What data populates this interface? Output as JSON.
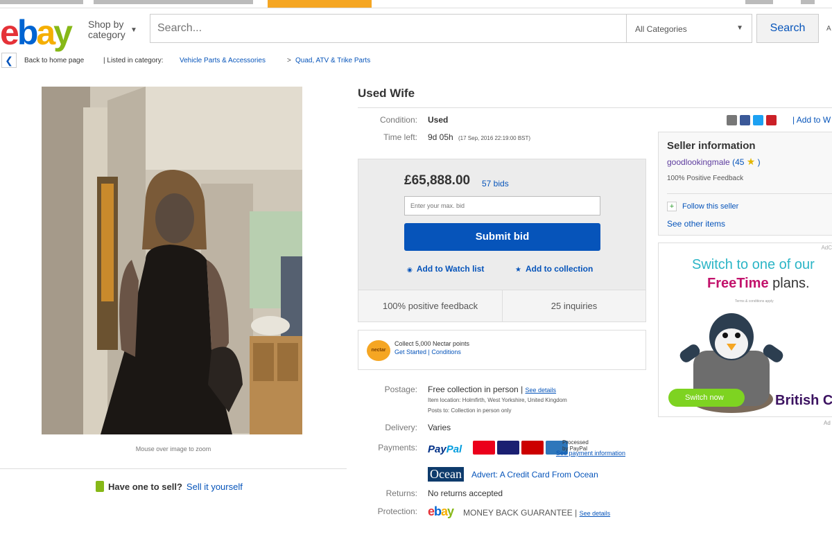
{
  "header": {
    "logo": {
      "e": "e",
      "b": "b",
      "a": "a",
      "y": "y"
    },
    "shop_by": "Shop by",
    "category": "category",
    "search_placeholder": "Search...",
    "category_select": "All Categories",
    "search_button": "Search",
    "advanced": "A"
  },
  "breadcrumb": {
    "back": "Back to home page",
    "listed": "| Listed in category:",
    "cat1": "Vehicle Parts & Accessories",
    "sep": ">",
    "cat2": "Quad, ATV & Trike Parts"
  },
  "photo": {
    "caption": "Mouse over image to zoom"
  },
  "sell": {
    "question": "Have one to sell?",
    "link": "Sell it yourself"
  },
  "item": {
    "title": "Used Wife",
    "condition_label": "Condition:",
    "condition": "Used",
    "time_label": "Time left:",
    "time_left": "9d 05h",
    "time_end": "(17 Sep, 2016   22:19:00 BST)"
  },
  "bid": {
    "price": "£65,888.00",
    "bids": "57 bids",
    "input_placeholder": "Enter your max. bid",
    "submit": "Submit bid",
    "watch": "Add to Watch list",
    "collection": "Add to collection",
    "feedback": "100% positive feedback",
    "inquiries": "25 inquiries"
  },
  "nectar": {
    "badge": "nectar",
    "line1": "Collect 5,000 Nectar points",
    "line2": "Get Started  |  Conditions"
  },
  "share": {
    "add_to": "| Add to W"
  },
  "seller": {
    "heading": "Seller information",
    "name": "goodlookingmale",
    "score": "(45",
    "close": ")",
    "feedback": "100% Positive Feedback",
    "follow": "Follow this seller",
    "other": "See other items"
  },
  "ad": {
    "adchoices": "AdC",
    "line1": "Switch to one of our",
    "line2_prefix": "",
    "freetime": "FreeTime",
    "line2_suffix": " plans.",
    "tiny": "Terms & conditions apply",
    "switch": "Switch now",
    "brand": "British C",
    "ad_label": "Ad"
  },
  "shipping": {
    "postage_label": "Postage:",
    "postage": "Free collection in person",
    "see_details": "See details",
    "location": "Item location:  Holmfirth, West Yorkshire, United Kingdom",
    "posts_to": "Posts to:  Collection in person only",
    "delivery_label": "Delivery:",
    "delivery": "Varies",
    "payments_label": "Payments:",
    "paypal1": "Pay",
    "paypal2": "Pal",
    "processed": "Processed\nby PayPal",
    "see_payment": "See payment information",
    "ocean": "Ocean",
    "ocean_advert": "Advert: A Credit Card From Ocean",
    "returns_label": "Returns:",
    "returns": "No returns accepted",
    "protection_label": "Protection:",
    "mbg": "MONEY BACK GUARANTEE",
    "see_details2": "See details"
  },
  "colors": {
    "ebay_red": "#e53238",
    "ebay_blue": "#0654ba",
    "ebay_yellow": "#f5af02",
    "ebay_green": "#86b817"
  }
}
